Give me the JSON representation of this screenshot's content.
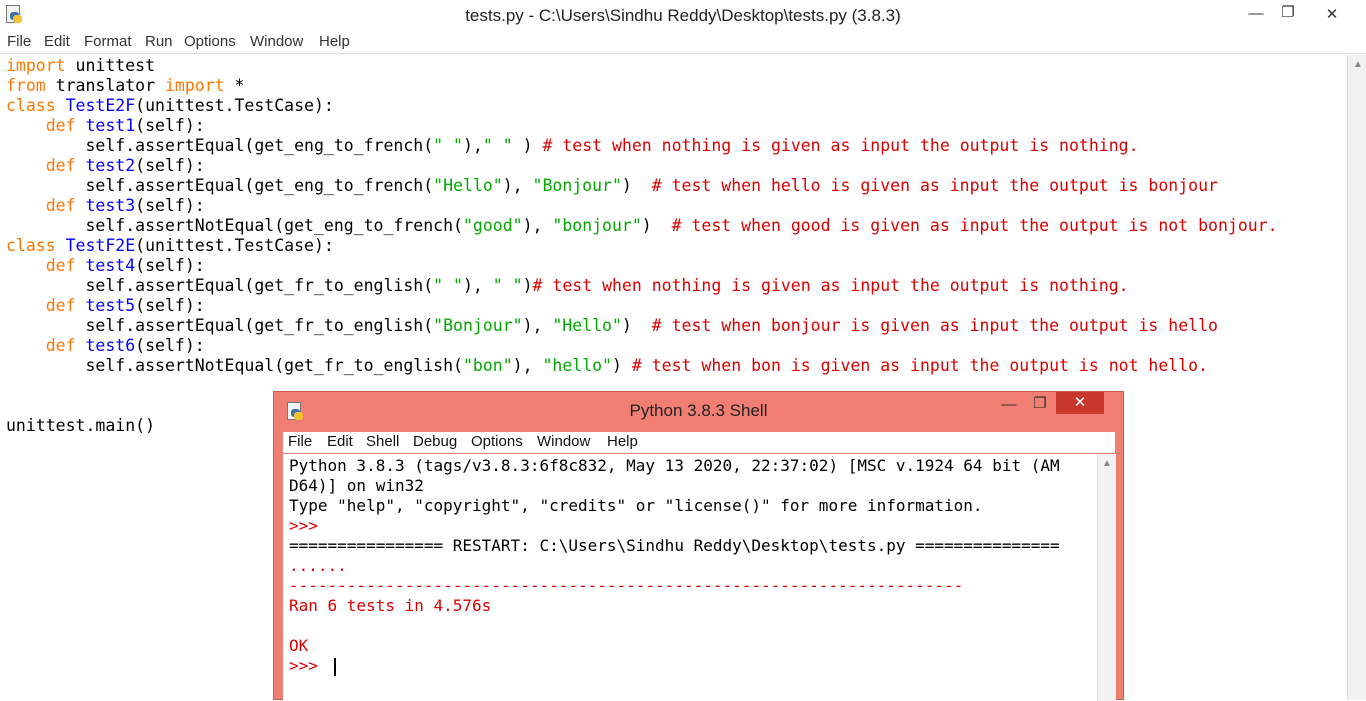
{
  "editor_window": {
    "title": "tests.py - C:\\Users\\Sindhu Reddy\\Desktop\\tests.py (3.8.3)",
    "menu": [
      "File",
      "Edit",
      "Format",
      "Run",
      "Options",
      "Window",
      "Help"
    ],
    "controls": {
      "minimize": "—",
      "maximize": "❐",
      "close": "✕"
    },
    "code_lines": [
      [
        {
          "t": "import",
          "c": "kw"
        },
        {
          "t": " unittest",
          "c": ""
        }
      ],
      [
        {
          "t": "from",
          "c": "kw"
        },
        {
          "t": " translator ",
          "c": ""
        },
        {
          "t": "import",
          "c": "kw"
        },
        {
          "t": " *",
          "c": ""
        }
      ],
      [
        {
          "t": "class",
          "c": "kw"
        },
        {
          "t": " ",
          "c": ""
        },
        {
          "t": "TestE2F",
          "c": "df"
        },
        {
          "t": "(unittest.TestCase):",
          "c": ""
        }
      ],
      [
        {
          "t": "    ",
          "c": ""
        },
        {
          "t": "def",
          "c": "kw"
        },
        {
          "t": " ",
          "c": ""
        },
        {
          "t": "test1",
          "c": "df"
        },
        {
          "t": "(self):",
          "c": ""
        }
      ],
      [
        {
          "t": "        self.assertEqual(get_eng_to_french(",
          "c": ""
        },
        {
          "t": "\" \"",
          "c": "st"
        },
        {
          "t": "),",
          "c": ""
        },
        {
          "t": "\" \"",
          "c": "st"
        },
        {
          "t": " ) ",
          "c": ""
        },
        {
          "t": "# test when nothing is given as input the output is nothing.",
          "c": "cm"
        }
      ],
      [
        {
          "t": "    ",
          "c": ""
        },
        {
          "t": "def",
          "c": "kw"
        },
        {
          "t": " ",
          "c": ""
        },
        {
          "t": "test2",
          "c": "df"
        },
        {
          "t": "(self):",
          "c": ""
        }
      ],
      [
        {
          "t": "        self.assertEqual(get_eng_to_french(",
          "c": ""
        },
        {
          "t": "\"Hello\"",
          "c": "st"
        },
        {
          "t": "), ",
          "c": ""
        },
        {
          "t": "\"Bonjour\"",
          "c": "st"
        },
        {
          "t": ")  ",
          "c": ""
        },
        {
          "t": "# test when hello is given as input the output is bonjour",
          "c": "cm"
        }
      ],
      [
        {
          "t": "    ",
          "c": ""
        },
        {
          "t": "def",
          "c": "kw"
        },
        {
          "t": " ",
          "c": ""
        },
        {
          "t": "test3",
          "c": "df"
        },
        {
          "t": "(self):",
          "c": ""
        }
      ],
      [
        {
          "t": "        self.assertNotEqual(get_eng_to_french(",
          "c": ""
        },
        {
          "t": "\"good\"",
          "c": "st"
        },
        {
          "t": "), ",
          "c": ""
        },
        {
          "t": "\"bonjour\"",
          "c": "st"
        },
        {
          "t": ")  ",
          "c": ""
        },
        {
          "t": "# test when good is given as input the output is not bonjour.",
          "c": "cm"
        }
      ],
      [
        {
          "t": "class",
          "c": "kw"
        },
        {
          "t": " ",
          "c": ""
        },
        {
          "t": "TestF2E",
          "c": "df"
        },
        {
          "t": "(unittest.TestCase):",
          "c": ""
        }
      ],
      [
        {
          "t": "    ",
          "c": ""
        },
        {
          "t": "def",
          "c": "kw"
        },
        {
          "t": " ",
          "c": ""
        },
        {
          "t": "test4",
          "c": "df"
        },
        {
          "t": "(self):",
          "c": ""
        }
      ],
      [
        {
          "t": "        self.assertEqual(get_fr_to_english(",
          "c": ""
        },
        {
          "t": "\" \"",
          "c": "st"
        },
        {
          "t": "), ",
          "c": ""
        },
        {
          "t": "\" \"",
          "c": "st"
        },
        {
          "t": ")",
          "c": ""
        },
        {
          "t": "# test when nothing is given as input the output is nothing.",
          "c": "cm"
        }
      ],
      [
        {
          "t": "    ",
          "c": ""
        },
        {
          "t": "def",
          "c": "kw"
        },
        {
          "t": " ",
          "c": ""
        },
        {
          "t": "test5",
          "c": "df"
        },
        {
          "t": "(self):",
          "c": ""
        }
      ],
      [
        {
          "t": "        self.assertEqual(get_fr_to_english(",
          "c": ""
        },
        {
          "t": "\"Bonjour\"",
          "c": "st"
        },
        {
          "t": "), ",
          "c": ""
        },
        {
          "t": "\"Hello\"",
          "c": "st"
        },
        {
          "t": ")  ",
          "c": ""
        },
        {
          "t": "# test when bonjour is given as input the output is hello",
          "c": "cm"
        }
      ],
      [
        {
          "t": "    ",
          "c": ""
        },
        {
          "t": "def",
          "c": "kw"
        },
        {
          "t": " ",
          "c": ""
        },
        {
          "t": "test6",
          "c": "df"
        },
        {
          "t": "(self):",
          "c": ""
        }
      ],
      [
        {
          "t": "        self.assertNotEqual(get_fr_to_english(",
          "c": ""
        },
        {
          "t": "\"bon\"",
          "c": "st"
        },
        {
          "t": "), ",
          "c": ""
        },
        {
          "t": "\"hello\"",
          "c": "st"
        },
        {
          "t": ") ",
          "c": ""
        },
        {
          "t": "# test when bon is given as input the output is not hello.",
          "c": "cm"
        }
      ],
      [
        {
          "t": "",
          "c": ""
        }
      ],
      [
        {
          "t": "",
          "c": ""
        }
      ],
      [
        {
          "t": "unittest.main()",
          "c": ""
        }
      ]
    ]
  },
  "shell_window": {
    "title": "Python 3.8.3 Shell",
    "menu": [
      "File",
      "Edit",
      "Shell",
      "Debug",
      "Options",
      "Window",
      "Help"
    ],
    "controls": {
      "minimize": "—",
      "maximize": "❐",
      "close": "✕"
    },
    "lines": [
      {
        "t": "Python 3.8.3 (tags/v3.8.3:6f8c832, May 13 2020, 22:37:02) [MSC v.1924 64 bit (AM",
        "c": ""
      },
      {
        "t": "D64)] on win32",
        "c": ""
      },
      {
        "t": "Type \"help\", \"copyright\", \"credits\" or \"license()\" for more information.",
        "c": ""
      },
      {
        "t": ">>> ",
        "c": "red"
      },
      {
        "t": "================ RESTART: C:\\Users\\Sindhu Reddy\\Desktop\\tests.py ===============",
        "c": ""
      },
      {
        "t": "......",
        "c": "red"
      },
      {
        "t": "----------------------------------------------------------------------",
        "c": "red"
      },
      {
        "t": "Ran 6 tests in 4.576s",
        "c": "red"
      },
      {
        "t": "",
        "c": ""
      },
      {
        "t": "OK",
        "c": "red"
      }
    ],
    "prompt": ">>> "
  },
  "colors": {
    "keyword": "#ff7700",
    "definition": "#0000ff",
    "string": "#00aa00",
    "comment": "#dd0000",
    "shell_frame": "#f17e72",
    "close_button": "#c7372c"
  }
}
